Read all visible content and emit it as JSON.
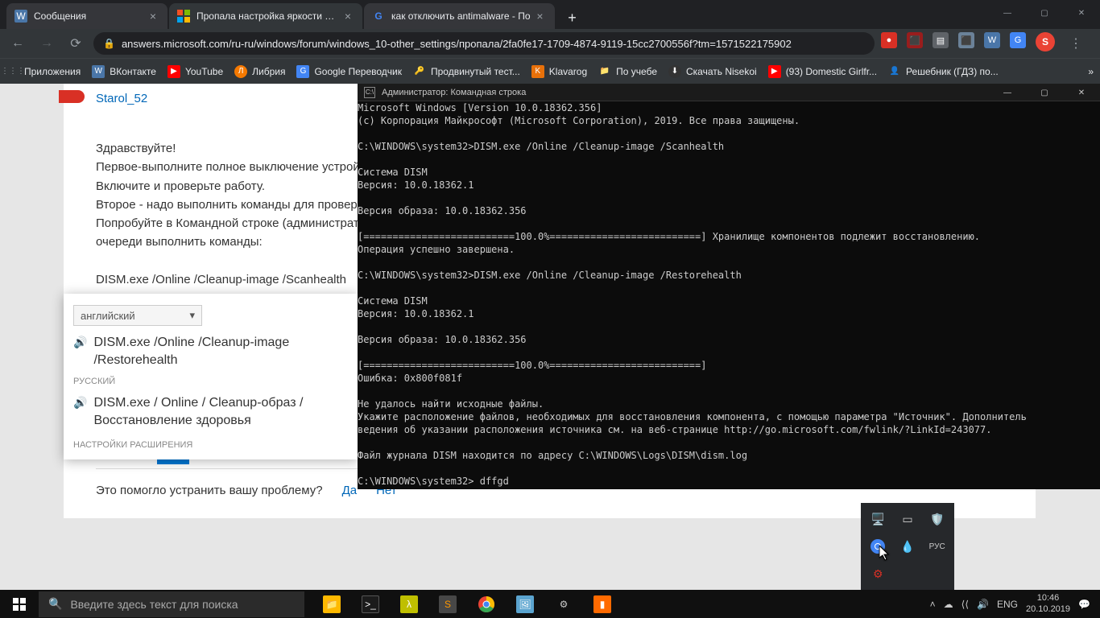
{
  "tabs": [
    {
      "title": "Сообщения",
      "favicon": "💬"
    },
    {
      "title": "Пропала настройка яркости экр",
      "favicon": "⊞",
      "active": true
    },
    {
      "title": "как отключить antimalware - По",
      "favicon": "G"
    }
  ],
  "address": {
    "url": "answers.microsoft.com/ru-ru/windows/forum/windows_10-other_settings/пропала/2fa0fe17-1709-4874-9119-15cc2700556f?tm=1571522175902"
  },
  "avatar_letter": "S",
  "bookmarks": [
    {
      "label": "Приложения"
    },
    {
      "label": "ВКонтакте"
    },
    {
      "label": "YouTube"
    },
    {
      "label": "Либрия"
    },
    {
      "label": "Google Переводчик"
    },
    {
      "label": "Продвинутый тест..."
    },
    {
      "label": "Klavarog"
    },
    {
      "label": "По учебе"
    },
    {
      "label": "Скачать Nisekoi"
    },
    {
      "label": "(93) Domestic Girlfr..."
    },
    {
      "label": "Решебник (ГДЗ) по..."
    }
  ],
  "forum": {
    "username": "Starol_52",
    "greeting": "Здравствуйте!",
    "line1": "Первое-выполните полное выключение устройства",
    "line2": "Включите и проверьте работу.",
    "line3": "Второе - надо выполнить команды для проверки",
    "line4": "Попробуйте в Командной строке (администратор)",
    "line5": "очереди выполнить команды:",
    "cmd1": "DISM.exe /Online /Cleanup-image /Scanhealth",
    "cmd2": "DISM.exe /Online /Cleanup-image /Restorehealth",
    "feedback_q": "Это помогло устранить вашу проблему?",
    "yes": "Да",
    "no": "Нет"
  },
  "translate": {
    "lang": "английский",
    "src_text": "DISM.exe /Online /Cleanup-image /Restorehealth",
    "target_label": "РУССКИЙ",
    "target_text": "DISM.exe / Online / Cleanup-образ / Восстановление здоровья",
    "settings": "НАСТРОЙКИ РАСШИРЕНИЯ"
  },
  "cmd": {
    "title": "Администратор: Командная строка",
    "body": "Microsoft Windows [Version 10.0.18362.356]\n(c) Корпорация Майкрософт (Microsoft Corporation), 2019. Все права защищены.\n\nC:\\WINDOWS\\system32>DISM.exe /Online /Cleanup-image /Scanhealth\n\nСистема DISM\nВерсия: 10.0.18362.1\n\nВерсия образа: 10.0.18362.356\n\n[==========================100.0%==========================] Хранилище компонентов подлежит восстановлению.\nОперация успешно завершена.\n\nC:\\WINDOWS\\system32>DISM.exe /Online /Cleanup-image /Restorehealth\n\nСистема DISM\nВерсия: 10.0.18362.1\n\nВерсия образа: 10.0.18362.356\n\n[==========================100.0%==========================]\nОшибка: 0x800f081f\n\nНе удалось найти исходные файлы.\nУкажите расположение файлов, необходимых для восстановления компонента, с помощью параметра \"Источник\". Дополнитель\nведения об указании расположения источника см. на веб-странице http://go.microsoft.com/fwlink/?LinkId=243077.\n\nФайл журнала DISM находится по адресу C:\\WINDOWS\\Logs\\DISM\\dism.log\n\nC:\\WINDOWS\\system32> dffgd"
  },
  "taskbar": {
    "search_placeholder": "Введите здесь текст для поиска",
    "lang": "ENG",
    "time": "10:46",
    "date": "20.10.2019"
  }
}
